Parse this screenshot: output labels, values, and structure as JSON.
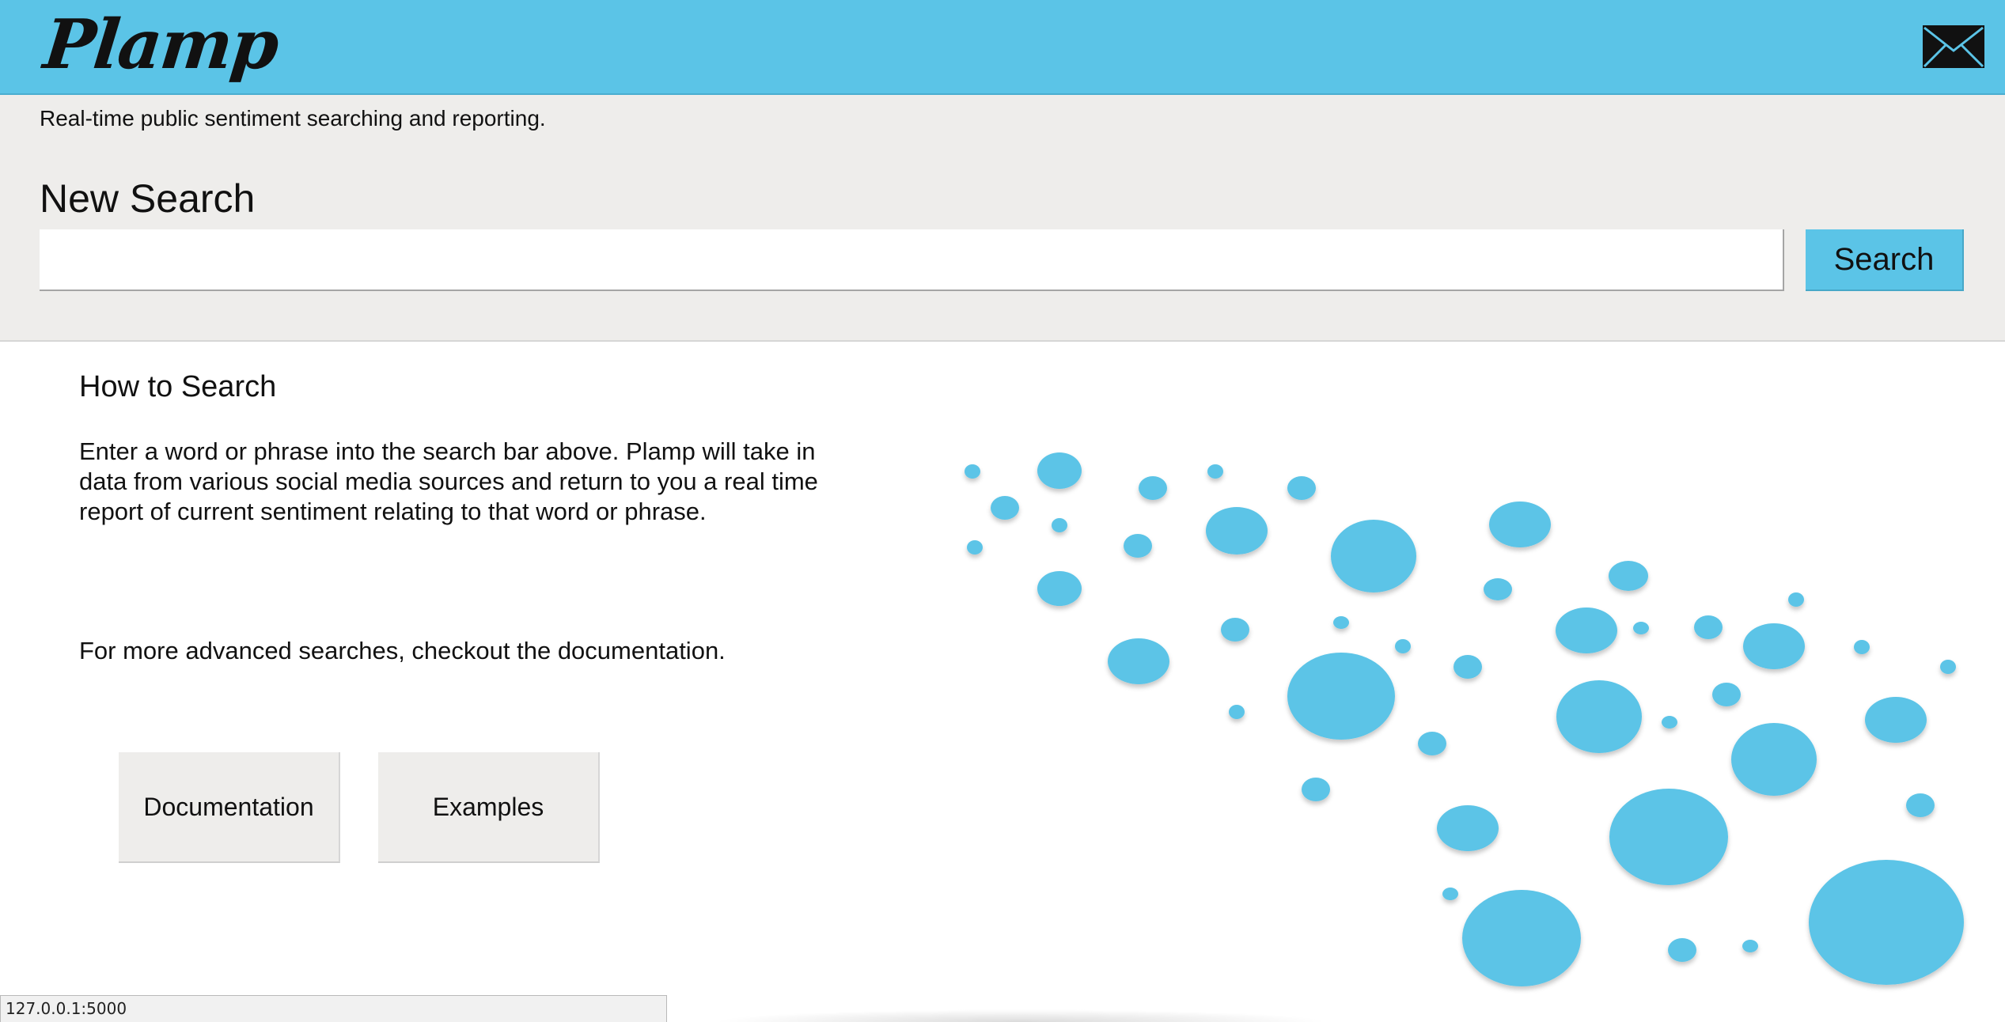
{
  "header": {
    "logo_text": "Plamp",
    "mail_icon": "envelope-icon",
    "colors": {
      "accent": "#5bc4e7",
      "panel": "#eeedeb"
    }
  },
  "search_panel": {
    "tagline": "Real-time public sentiment searching and reporting.",
    "title": "New Search",
    "input_value": "",
    "input_placeholder": "",
    "button_label": "Search"
  },
  "help": {
    "title": "How to Search",
    "description": "Enter a word or phrase into the search bar above. Plamp will take in data from various social media sources and return to you a real time report of current sentiment relating to that word or phrase.",
    "advanced": "For more advanced searches, checkout the documentation.",
    "documentation_button": "Documentation",
    "examples_button": "Examples"
  },
  "status_bar": {
    "url": "127.0.0.1:5000"
  }
}
